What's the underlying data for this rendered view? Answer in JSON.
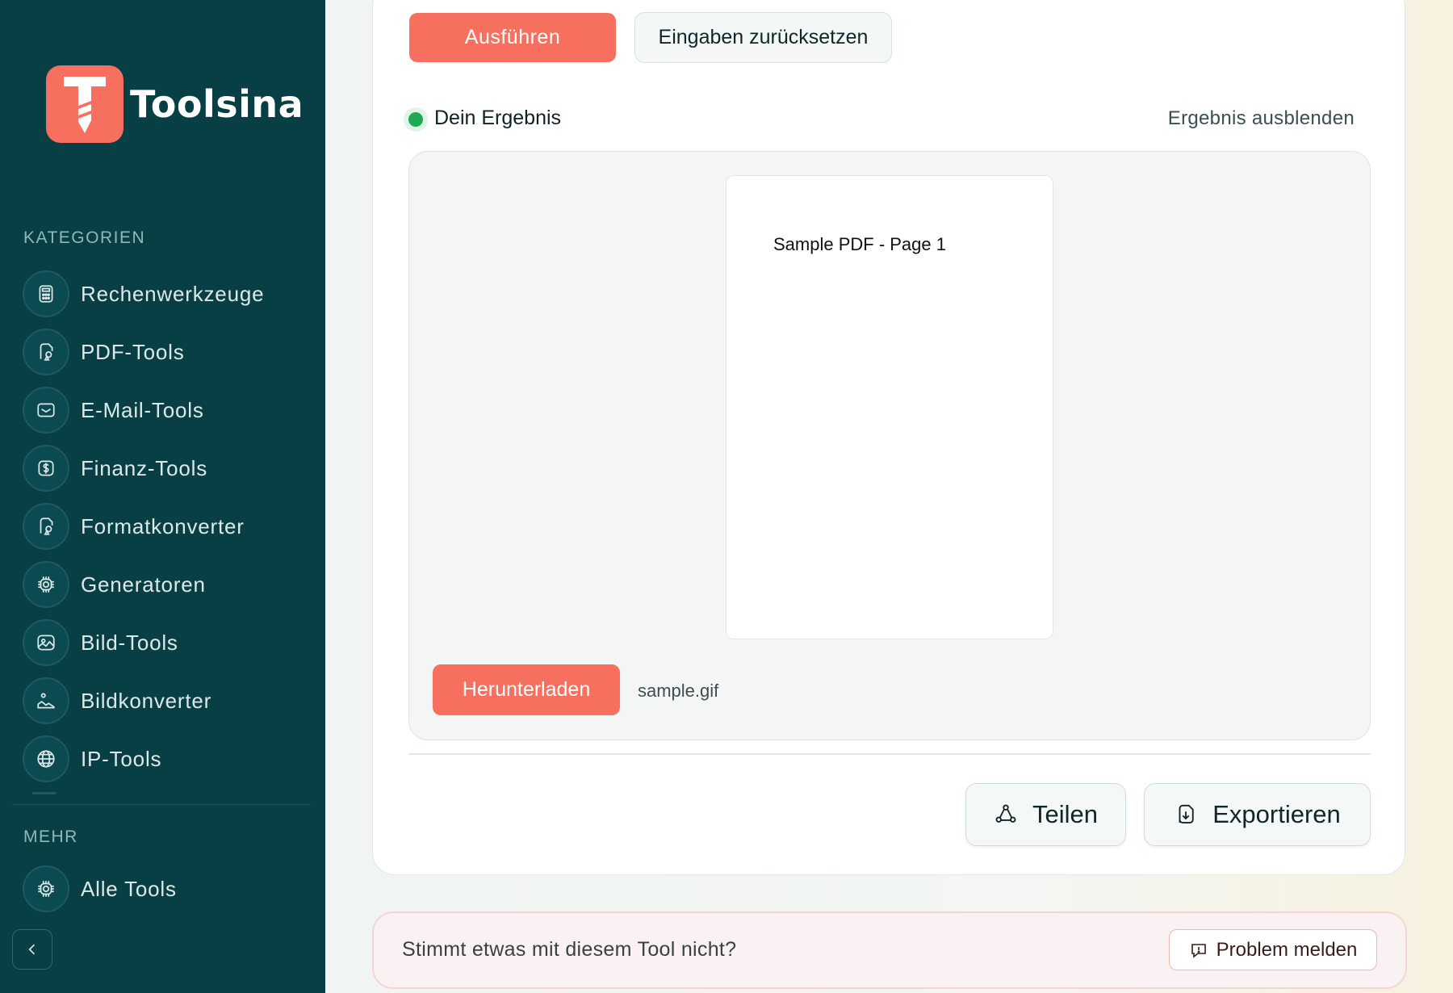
{
  "app": {
    "name": "Toolsina",
    "brand_color": "#f7705f",
    "sidebar_color": "#073f45"
  },
  "sidebar": {
    "categories_label": "KATEGORIEN",
    "items": [
      {
        "label": "Rechenwerkzeuge",
        "icon": "calculator-icon"
      },
      {
        "label": "PDF-Tools",
        "icon": "file-shapes-icon"
      },
      {
        "label": "E-Mail-Tools",
        "icon": "mail-icon"
      },
      {
        "label": "Finanz-Tools",
        "icon": "dollar-icon"
      },
      {
        "label": "Formatkonverter",
        "icon": "file-shapes-icon"
      },
      {
        "label": "Generatoren",
        "icon": "gear-chip-icon"
      },
      {
        "label": "Bild-Tools",
        "icon": "image-icon"
      },
      {
        "label": "Bildkonverter",
        "icon": "image-convert-icon"
      },
      {
        "label": "IP-Tools",
        "icon": "globe-icon"
      }
    ],
    "more_label": "MEHR",
    "more_items": [
      {
        "label": "Alle Tools",
        "icon": "gear-chip-icon"
      }
    ],
    "collapse_icon": "chevron-left-icon"
  },
  "toolbar": {
    "run_label": "Ausführen",
    "reset_label": "Eingaben zurücksetzen"
  },
  "result": {
    "title": "Dein Ergebnis",
    "hide_label": "Ergebnis ausblenden",
    "status_color": "#1fa855",
    "preview_text": "Sample PDF - Page 1",
    "download_label": "Herunterladen",
    "filename": "sample.gif"
  },
  "actions": {
    "share_label": "Teilen",
    "export_label": "Exportieren"
  },
  "feedback": {
    "question": "Stimmt etwas mit diesem Tool nicht?",
    "report_label": "Problem melden"
  }
}
